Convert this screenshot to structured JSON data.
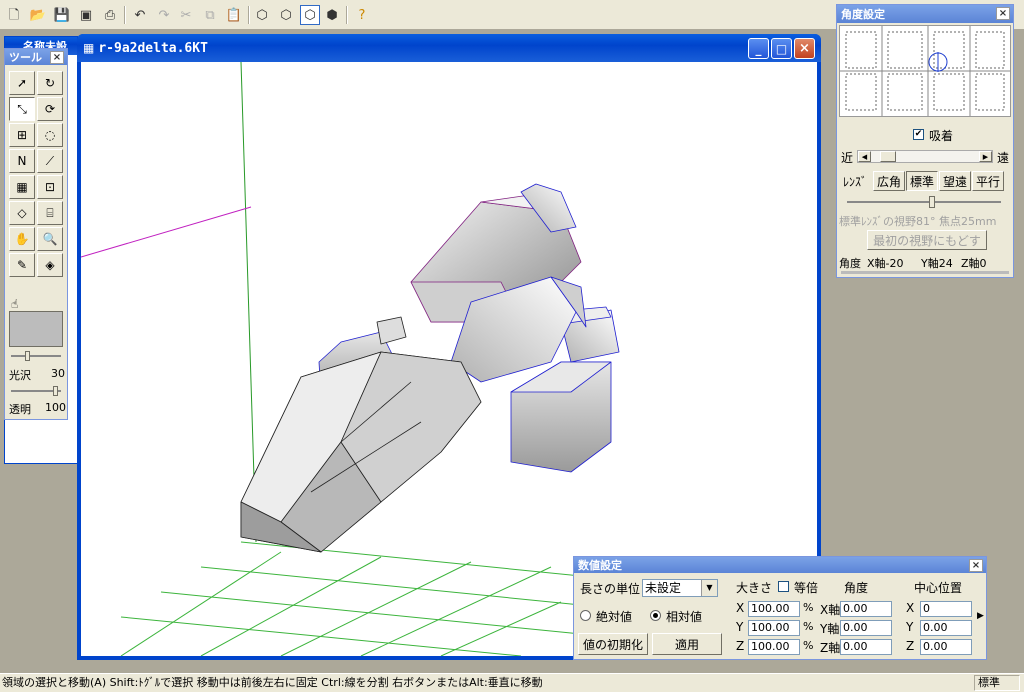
{
  "toolbar": {
    "icons": [
      "new-file-icon",
      "open-folder-icon",
      "save-icon",
      "save-all-icon",
      "print-icon",
      "undo-icon",
      "redo-icon",
      "cut-icon",
      "copy-icon",
      "paste-icon",
      "view-front-icon",
      "view-side-icon",
      "view-top-icon",
      "view-perspective-icon",
      "help-icon"
    ]
  },
  "back_window": {
    "title": "名称未設"
  },
  "tool_palette": {
    "title": "ツール",
    "gloss_label": "光沢",
    "gloss_value": "30",
    "transparency_label": "透明",
    "transparency_value": "100"
  },
  "doc_window": {
    "title": "r-9a2delta.6KT",
    "minimize": "_",
    "maximize": "□",
    "close": "×"
  },
  "angle_panel": {
    "title": "角度設定",
    "snap_label": "吸着",
    "snap_checked": true,
    "near_label": "近",
    "far_label": "遠",
    "lens_label": "ﾚﾝｽﾞ",
    "lens_buttons": [
      "広角",
      "標準",
      "望遠",
      "平行"
    ],
    "lens_info": "標準ﾚﾝｽﾞの視野81° 焦点25mm",
    "reset_view": "最初の視野にもどす",
    "angle_label": "角度",
    "x_axis": "X軸-20",
    "y_axis": "Y軸24",
    "z_axis": "Z軸0"
  },
  "numeric_panel": {
    "title": "数値設定",
    "length_unit_label": "長さの単位",
    "length_unit_value": "未設定",
    "absolute_label": "絶対値",
    "relative_label": "相対値",
    "reset_button": "値の初期化",
    "apply_button": "適用",
    "size_label": "大きさ",
    "uniform_label": "等倍",
    "angle_label": "角度",
    "center_label": "中心位置",
    "x": "X",
    "y": "Y",
    "z": "Z",
    "x_axis": "X軸",
    "y_axis": "Y軸",
    "z_axis": "Z軸",
    "percent": "%",
    "size_values": [
      "100.00",
      "100.00",
      "100.00"
    ],
    "angle_values": [
      "0.00",
      "0.00",
      "0.00"
    ],
    "center_values": [
      "0",
      "0.00",
      "0.00"
    ]
  },
  "status": {
    "text": "領域の選択と移動(A)  Shift:ﾄｸﾞﾙで選択 移動中は前後左右に固定  Ctrl:線を分割  右ボタンまたはAlt:垂直に移動",
    "mode": "標準"
  }
}
